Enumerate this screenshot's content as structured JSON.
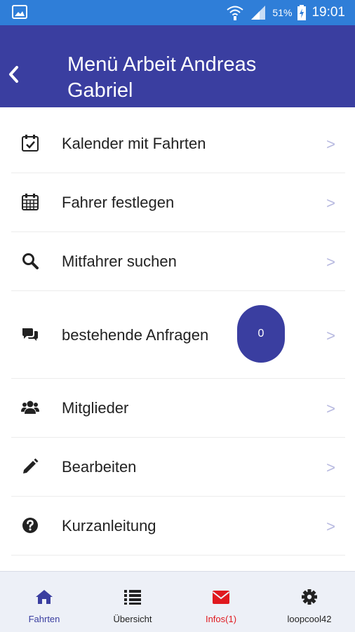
{
  "status_bar": {
    "battery": "51%",
    "time": "19:01",
    "icons": [
      "gallery-icon",
      "wifi-icon",
      "signal-icon",
      "battery-icon"
    ]
  },
  "app_bar": {
    "title_line1": "Menü Arbeit Andreas",
    "title_line2": "Gabriel",
    "back_icon": "chevron-left-icon"
  },
  "menu": {
    "items": [
      {
        "label": "Kalender mit Fahrten",
        "icon": "calendar-check-icon",
        "chevron": ">"
      },
      {
        "label": "Fahrer festlegen",
        "icon": "calendar-icon",
        "chevron": ">"
      },
      {
        "label": "Mitfahrer suchen",
        "icon": "search-icon",
        "chevron": ">"
      },
      {
        "label": "bestehende Anfragen",
        "icon": "comments-icon",
        "chevron": ">",
        "badge": "0"
      },
      {
        "label": "Mitglieder",
        "icon": "users-icon",
        "chevron": ">"
      },
      {
        "label": "Bearbeiten",
        "icon": "pencil-icon",
        "chevron": ">"
      },
      {
        "label": "Kurzanleitung",
        "icon": "question-circle-icon",
        "chevron": ">"
      }
    ]
  },
  "tab_bar": {
    "tabs": [
      {
        "label": "Fahrten",
        "icon": "home-icon",
        "color": "#3a3ea0"
      },
      {
        "label": "Übersicht",
        "icon": "list-icon",
        "color": "#222222"
      },
      {
        "label": "Infos(1)",
        "icon": "envelope-icon",
        "color": "#e0191f"
      },
      {
        "label": "loopcool42",
        "icon": "gear-icon",
        "color": "#222222"
      }
    ]
  },
  "colors": {
    "status_bar": "#2f7ed8",
    "app_bar": "#3a3ea0",
    "chevron": "#b7b9e0",
    "tab_bar": "#edf0f7",
    "alert": "#e0191f"
  }
}
